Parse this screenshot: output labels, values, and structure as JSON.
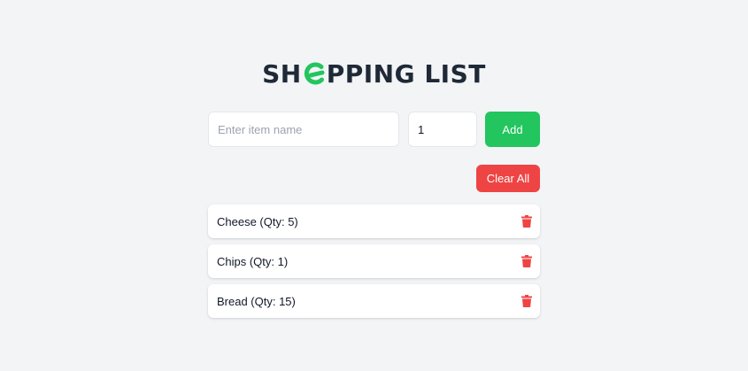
{
  "title": {
    "prefix": "SH",
    "suffix": "PPING LIST",
    "logo_icon": "logo-o-icon",
    "logo_color": "#22c55e"
  },
  "form": {
    "item_placeholder": "Enter item name",
    "item_value": "",
    "quantity_value": "1",
    "add_label": "Add"
  },
  "clear_label": "Clear All",
  "items": [
    {
      "label": "Cheese (Qty: 5)",
      "delete_icon": "trash-icon"
    },
    {
      "label": "Chips (Qty: 1)",
      "delete_icon": "trash-icon"
    },
    {
      "label": "Bread (Qty: 15)",
      "delete_icon": "trash-icon"
    }
  ],
  "colors": {
    "background": "#f3f4f6",
    "add_button": "#22c55e",
    "clear_button": "#ef4444",
    "delete_icon": "#ef4444",
    "title_text": "#1f2937"
  }
}
